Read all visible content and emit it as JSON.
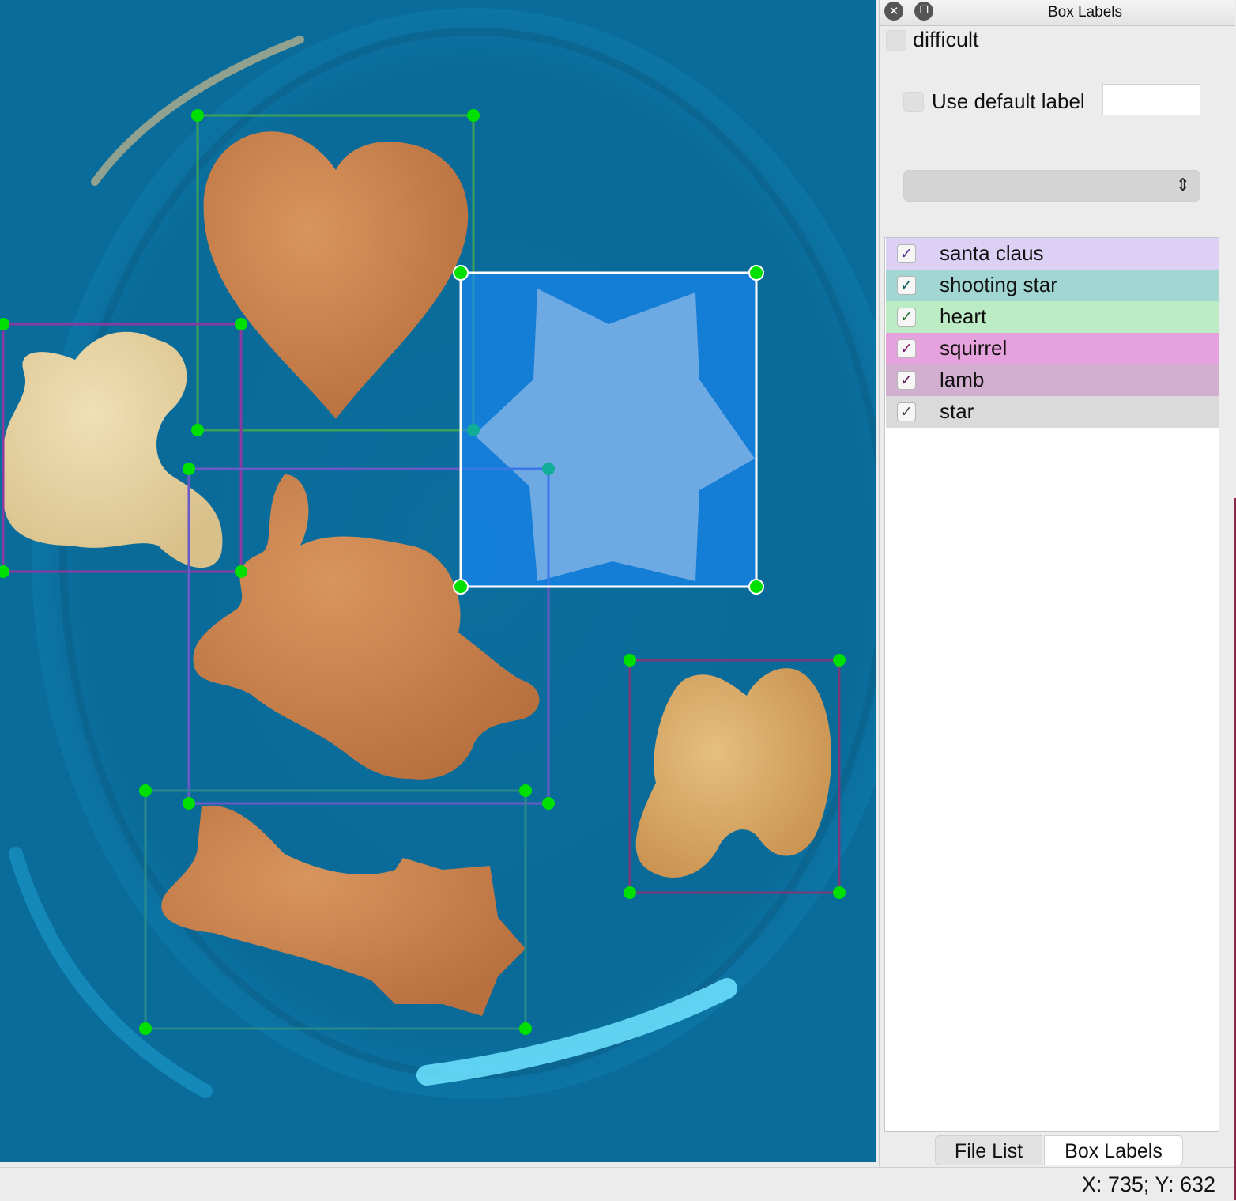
{
  "canvas": {
    "plate_color": "#0a6c9a",
    "boxes": [
      {
        "label": "heart",
        "color": "#3aa05a"
      },
      {
        "label": "lamb",
        "color": "#8a3aa0"
      },
      {
        "label": "star",
        "color": "#1a8bff",
        "selected": true
      },
      {
        "label": "santa claus",
        "color": "#6a5ac8"
      },
      {
        "label": "squirrel",
        "color": "#8a3a8a"
      },
      {
        "label": "shooting star",
        "color": "#2a8a8a"
      }
    ],
    "vertex_color": "#00e000"
  },
  "dock": {
    "title": "Box Labels",
    "close_icon": "close-icon",
    "float_icon": "float-icon",
    "difficult_label": "difficult",
    "use_default_label": "Use default label",
    "default_label_value": "",
    "combo_value": "",
    "labels": [
      {
        "text": "santa claus",
        "checked": true,
        "bg": "#dcd1f4",
        "tick": "#4a2a8a"
      },
      {
        "text": "shooting star",
        "checked": true,
        "bg": "#a2d6d2",
        "tick": "#0a5a5a"
      },
      {
        "text": "heart",
        "checked": true,
        "bg": "#bcecc4",
        "tick": "#1a6a2a"
      },
      {
        "text": "squirrel",
        "checked": true,
        "bg": "#e6a2dc",
        "tick": "#7a1a6a"
      },
      {
        "text": "lamb",
        "checked": true,
        "bg": "#d2aed0",
        "tick": "#5a1a5a"
      },
      {
        "text": "star",
        "checked": true,
        "bg": "#dadada",
        "tick": "#444444"
      }
    ],
    "tabs": {
      "file_list": "File List",
      "box_labels": "Box Labels"
    }
  },
  "status": {
    "coords": "X: 735; Y: 632"
  }
}
